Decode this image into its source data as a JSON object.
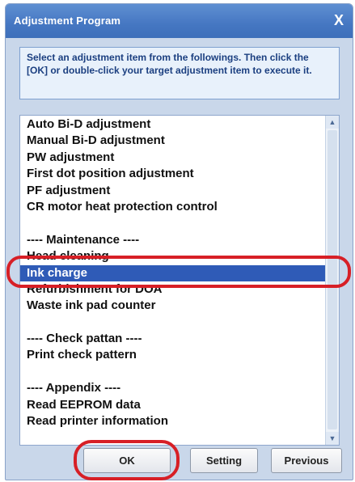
{
  "window": {
    "title": "Adjustment Program",
    "close_label": "X"
  },
  "instruction": "Select an adjustment item from the followings. Then click the [OK] or double-click your target adjustment item to execute it.",
  "list": {
    "items": [
      {
        "label": "Auto Bi-D adjustment"
      },
      {
        "label": "Manual Bi-D adjustment"
      },
      {
        "label": "PW adjustment"
      },
      {
        "label": "First dot position adjustment"
      },
      {
        "label": "PF adjustment"
      },
      {
        "label": "CR motor heat protection control"
      },
      {
        "label": ""
      },
      {
        "label": "---- Maintenance ----"
      },
      {
        "label": "Head cleaning"
      },
      {
        "label": "Ink charge",
        "selected": true
      },
      {
        "label": "Refurbishment for DOA"
      },
      {
        "label": "Waste ink pad counter"
      },
      {
        "label": ""
      },
      {
        "label": "---- Check pattan ----"
      },
      {
        "label": "Print check pattern"
      },
      {
        "label": ""
      },
      {
        "label": "---- Appendix ----"
      },
      {
        "label": "Read EEPROM data"
      },
      {
        "label": "Read printer information"
      }
    ],
    "scroll_up_icon": "▲",
    "scroll_down_icon": "▼"
  },
  "buttons": {
    "ok": "OK",
    "setting": "Setting",
    "previous": "Previous"
  },
  "colors": {
    "selection": "#2f5bb7",
    "highlight_ring": "#d71f26",
    "titlebar": "#4577c2"
  }
}
